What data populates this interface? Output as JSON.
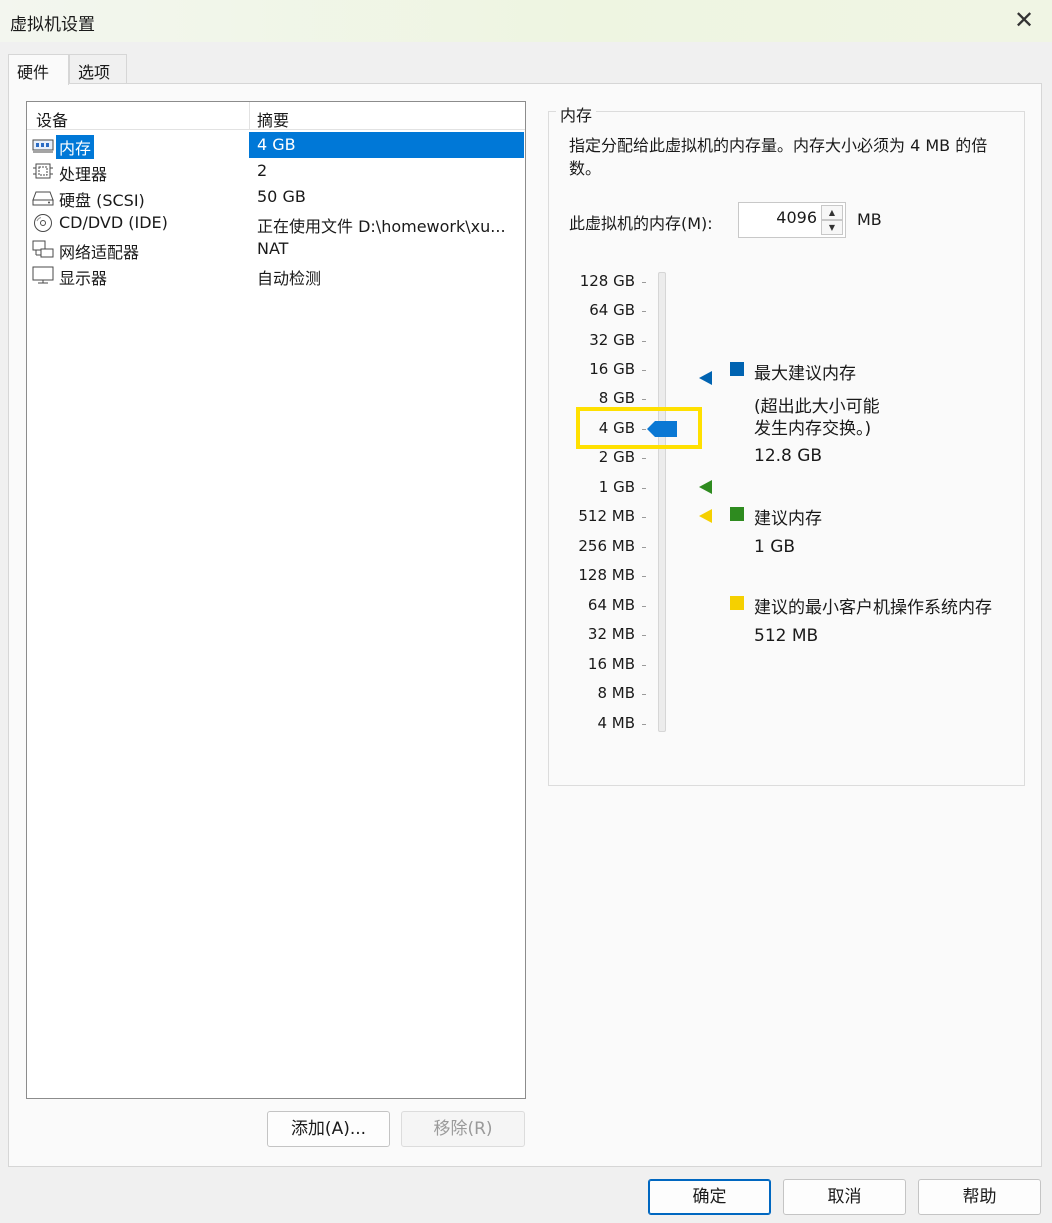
{
  "window": {
    "title": "虚拟机设置",
    "close_symbol": "✕"
  },
  "tabs": [
    {
      "label": "硬件",
      "active": true
    },
    {
      "label": "选项",
      "active": false
    }
  ],
  "device_list": {
    "columns": [
      "设备",
      "摘要"
    ],
    "rows": [
      {
        "name": "内存",
        "summary": "4 GB",
        "icon": "memory-icon",
        "selected": true
      },
      {
        "name": "处理器",
        "summary": "2",
        "icon": "processor-icon",
        "selected": false
      },
      {
        "name": "硬盘 (SCSI)",
        "summary": "50 GB",
        "icon": "harddisk-icon",
        "selected": false
      },
      {
        "name": "CD/DVD (IDE)",
        "summary": "正在使用文件 D:\\homework\\xu...",
        "icon": "cd-dvd-icon",
        "selected": false
      },
      {
        "name": "网络适配器",
        "summary": "NAT",
        "icon": "network-adapter-icon",
        "selected": false
      },
      {
        "name": "显示器",
        "summary": "自动检测",
        "icon": "display-icon",
        "selected": false
      }
    ]
  },
  "list_buttons": {
    "add": "添加(A)...",
    "remove": "移除(R)"
  },
  "memory": {
    "group_title": "内存",
    "description": "指定分配给此虚拟机的内存量。内存大小必须为 4 MB 的倍数。",
    "label": "此虚拟机的内存(M):",
    "value": "4096",
    "unit": "MB",
    "scale": [
      "128 GB",
      "64 GB",
      "32 GB",
      "16 GB",
      "8 GB",
      "4 GB",
      "2 GB",
      "1 GB",
      "512 MB",
      "256 MB",
      "128 MB",
      "64 MB",
      "32 MB",
      "16 MB",
      "8 MB",
      "4 MB"
    ],
    "current_setting": "4 GB",
    "legend": {
      "max": {
        "label": "最大建议内存",
        "note_line1": "(超出此大小可能",
        "note_line2": "发生内存交换。)",
        "value": "12.8 GB",
        "color": "#0063b1"
      },
      "recommended": {
        "label": "建议内存",
        "value": "1 GB",
        "color": "#2e8b1f"
      },
      "min": {
        "label": "建议的最小客户机操作系统内存",
        "value": "512 MB",
        "color": "#f5d000"
      }
    },
    "thumb_color": "#0a78d4",
    "highlight_color": "#ffe000"
  },
  "footer_buttons": {
    "ok": "确定",
    "cancel": "取消",
    "help": "帮助"
  }
}
